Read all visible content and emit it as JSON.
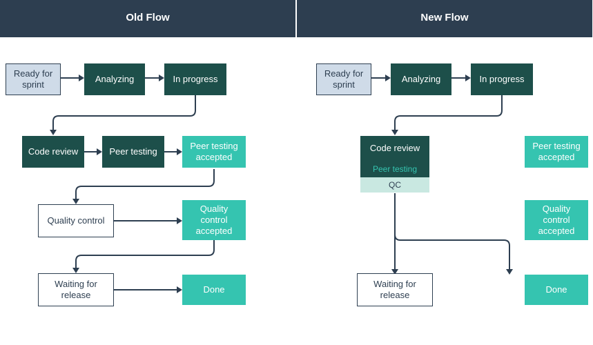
{
  "old_flow": {
    "title": "Old Flow",
    "nodes": {
      "ready": "Ready for sprint",
      "analyzing": "Analyzing",
      "in_progress": "In progress",
      "code_review": "Code review",
      "peer_testing": "Peer testing",
      "peer_testing_accepted": "Peer testing accepted",
      "quality_control": "Quality control",
      "quality_control_accepted": "Quality control accepted",
      "waiting_for_release": "Waiting for release",
      "done": "Done"
    }
  },
  "new_flow": {
    "title": "New Flow",
    "nodes": {
      "ready": "Ready for sprint",
      "analyzing": "Analyzing",
      "in_progress": "In progress",
      "code_review": "Code review",
      "peer_testing": "Peer testing",
      "qc": "QC",
      "peer_testing_accepted": "Peer testing accepted",
      "quality_control_accepted": "Quality control accepted",
      "waiting_for_release": "Waiting for release",
      "done": "Done"
    }
  }
}
